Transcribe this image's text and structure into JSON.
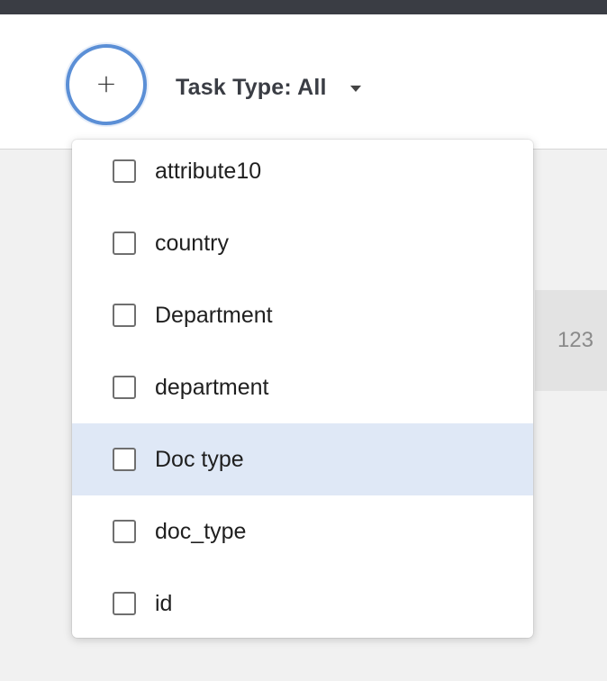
{
  "toolbar": {
    "add_button_symbol": "+",
    "add_button_icon": "plus-icon",
    "task_type_label": "Task Type: All",
    "caret_icon": "caret-down-icon"
  },
  "background": {
    "card_value": "123"
  },
  "dropdown": {
    "items": [
      {
        "label": "attribute10",
        "checked": false
      },
      {
        "label": "country",
        "checked": false
      },
      {
        "label": "Department",
        "checked": false
      },
      {
        "label": "department",
        "checked": false
      },
      {
        "label": "Doc type",
        "checked": false,
        "highlighted": true
      },
      {
        "label": "doc_type",
        "checked": false
      },
      {
        "label": "id",
        "checked": false
      }
    ]
  },
  "colors": {
    "top_strip": "#3a3d44",
    "accent_ring": "#5b8fd6",
    "highlight_row": "#dfe8f6"
  }
}
